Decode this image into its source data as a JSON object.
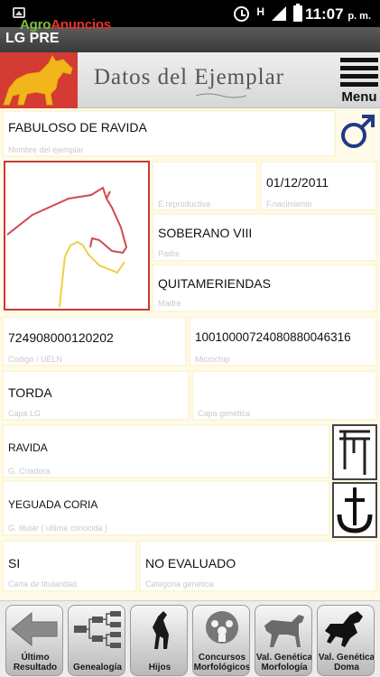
{
  "status_bar": {
    "network": "H",
    "time": "11:07",
    "ampm": "p. m."
  },
  "watermark": {
    "part1": "Agro",
    "part2": "Anuncios"
  },
  "app_title": "LG PRE",
  "header": {
    "title": "Datos del Ejemplar",
    "menu_label": "Menu"
  },
  "specimen": {
    "name": "FABULOSO DE RAVIDA",
    "name_label": "Nombre del ejemplar",
    "sex_icon": "male-symbol-icon",
    "birth_date": "01/12/2011",
    "breeding_label": "E.reproductiva",
    "birth_label": "F.nacimiento",
    "father": "SOBERANO VIII",
    "father_label": "Padre",
    "mother": "QUITAMERIENDAS",
    "mother_label": "Madre",
    "ueln": "724908000120202",
    "ueln_label": "Codigo / UELN",
    "microchip": "1001000072408088004631​6",
    "microchip_label": "Microchip",
    "coat": "TORDA",
    "coat_label": "Capa LG",
    "genetic_coat": "",
    "genetic_coat_label": "Capa genetica",
    "breeder": "RAVIDA",
    "breeder_label": "G. Criadora",
    "owner": "YEGUADA CORIA",
    "owner_label": "G. titular ( ultima conocida )",
    "sealed_card": "SI",
    "sealed_card_label": "Carta de titularidad",
    "genetic_category": "NO EVALUADO",
    "genetic_category_label": "Categoria genetica"
  },
  "bottom_nav": [
    {
      "label1": "Último",
      "label2": "Resultado",
      "icon": "back-arrow-icon"
    },
    {
      "label1": "Genealogía",
      "label2": "",
      "icon": "pedigree-tree-icon"
    },
    {
      "label1": "Hijos",
      "label2": "",
      "icon": "horse-offspring-icon"
    },
    {
      "label1": "Concursos",
      "label2": "Morfológicos",
      "icon": "competition-icon"
    },
    {
      "label1": "Val. Genética",
      "label2": "Morfología",
      "icon": "horse-standing-icon"
    },
    {
      "label1": "Val. Genética",
      "label2": "Doma",
      "icon": "horse-dressage-icon"
    }
  ],
  "colors": {
    "accent_red": "#c83a3a",
    "logo_yellow": "#f3b51c",
    "background_cream": "#fffbe8"
  }
}
